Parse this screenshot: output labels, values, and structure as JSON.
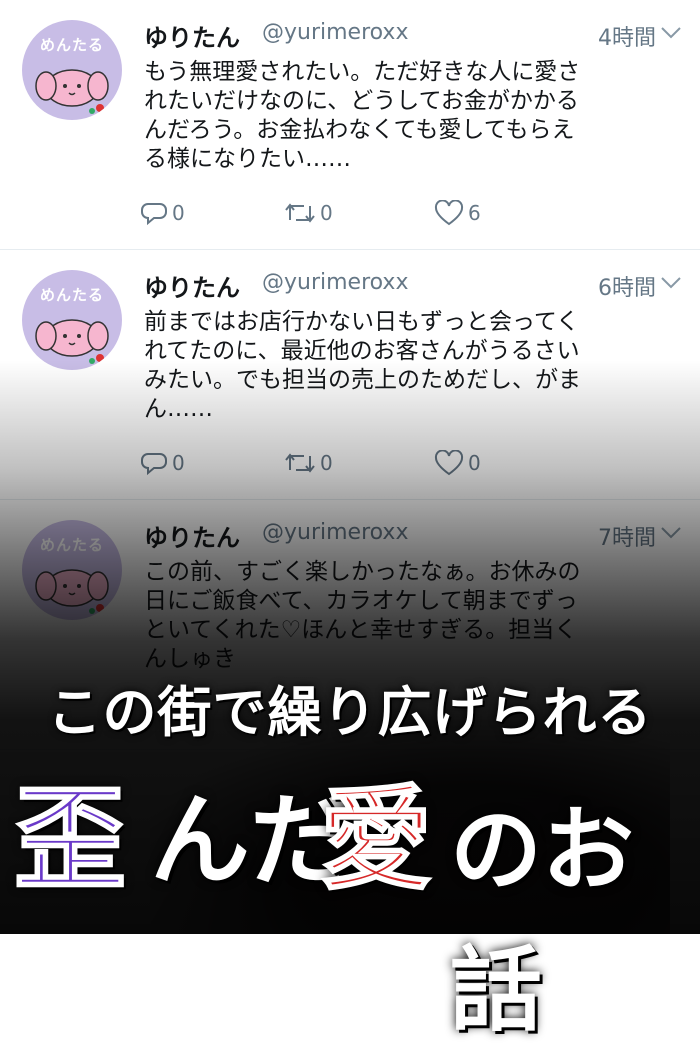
{
  "tweets": [
    {
      "avatar_label": "めんたる",
      "name": "ゆりたん",
      "handle": "@yurimeroxx",
      "time": "4時間",
      "text": "もう無理愛されたい。ただ好きな人に愛さ\nれたいだけなのに、どうしてお金がかかる\nんだろう。お金払わなくても愛してもらえ\nる様になりたい……",
      "replies": "0",
      "retweets": "0",
      "likes": "6"
    },
    {
      "avatar_label": "めんたる",
      "name": "ゆりたん",
      "handle": "@yurimeroxx",
      "time": "6時間",
      "text": "前まではお店行かない日もずっと会ってく\nれてたのに、最近他のお客さんがうるさい\nみたい。でも担当の売上のためだし、がま\nん……",
      "replies": "0",
      "retweets": "0",
      "likes": "0"
    },
    {
      "avatar_label": "めんたる",
      "name": "ゆりたん",
      "handle": "@yurimeroxx",
      "time": "7時間",
      "text": "この前、すごく楽しかったなぁ。お休みの\n日にご飯食べて、カラオケして朝までずっ\nといてくれた♡ほんと幸せすぎる。担当く\nんしゅき"
    }
  ],
  "headline": {
    "line1": "この街で繰り広げられる",
    "line2_words": [
      "歪",
      "んだ",
      "愛",
      "のお話"
    ]
  },
  "colors": {
    "avatar_bg": "#c8bde6",
    "accent_purple": "#6a39c9",
    "accent_red": "#d62828",
    "meta_gray": "#657786"
  },
  "icons": [
    "reply-icon",
    "retweet-icon",
    "like-icon",
    "chevron-down-icon"
  ]
}
